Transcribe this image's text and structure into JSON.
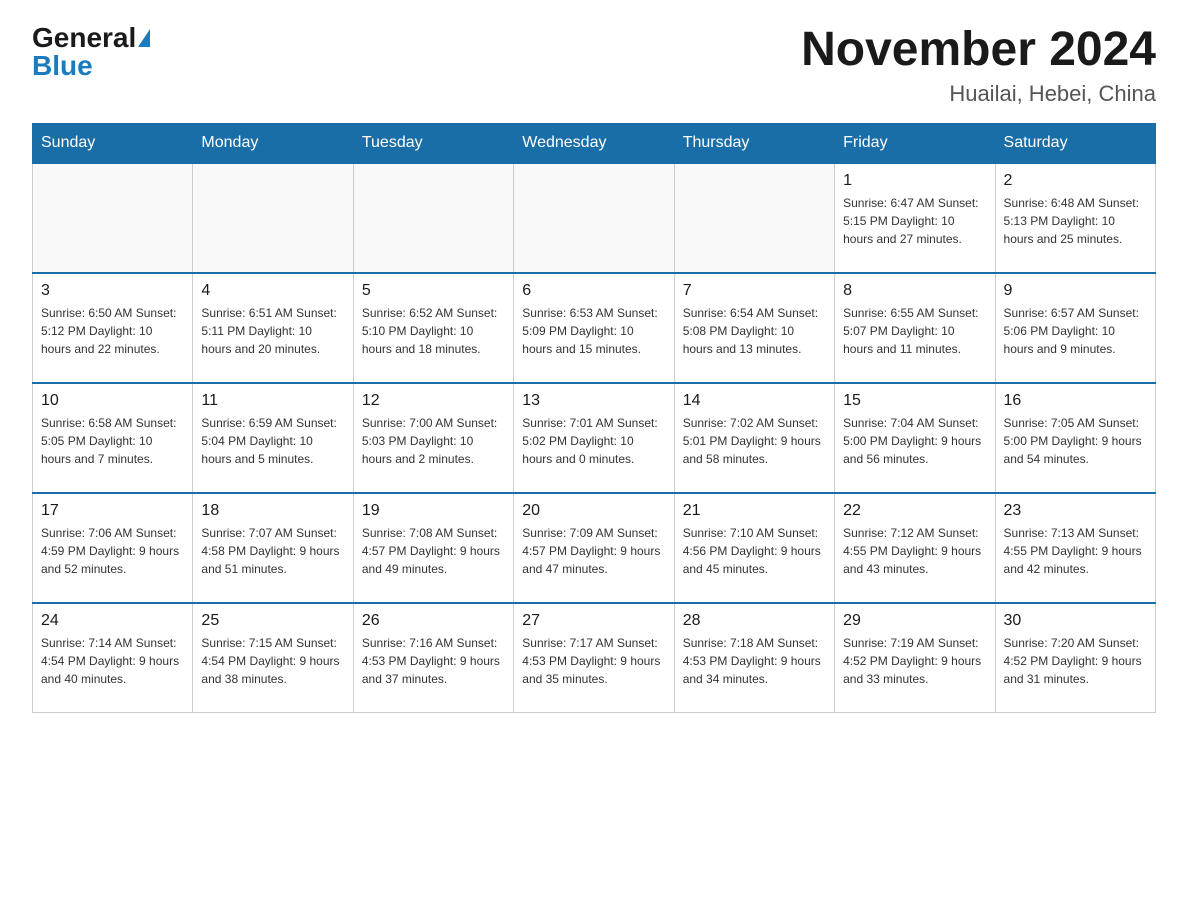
{
  "logo": {
    "general": "General",
    "blue": "Blue"
  },
  "title": "November 2024",
  "location": "Huailai, Hebei, China",
  "weekdays": [
    "Sunday",
    "Monday",
    "Tuesday",
    "Wednesday",
    "Thursday",
    "Friday",
    "Saturday"
  ],
  "weeks": [
    [
      {
        "day": "",
        "info": ""
      },
      {
        "day": "",
        "info": ""
      },
      {
        "day": "",
        "info": ""
      },
      {
        "day": "",
        "info": ""
      },
      {
        "day": "",
        "info": ""
      },
      {
        "day": "1",
        "info": "Sunrise: 6:47 AM\nSunset: 5:15 PM\nDaylight: 10 hours\nand 27 minutes."
      },
      {
        "day": "2",
        "info": "Sunrise: 6:48 AM\nSunset: 5:13 PM\nDaylight: 10 hours\nand 25 minutes."
      }
    ],
    [
      {
        "day": "3",
        "info": "Sunrise: 6:50 AM\nSunset: 5:12 PM\nDaylight: 10 hours\nand 22 minutes."
      },
      {
        "day": "4",
        "info": "Sunrise: 6:51 AM\nSunset: 5:11 PM\nDaylight: 10 hours\nand 20 minutes."
      },
      {
        "day": "5",
        "info": "Sunrise: 6:52 AM\nSunset: 5:10 PM\nDaylight: 10 hours\nand 18 minutes."
      },
      {
        "day": "6",
        "info": "Sunrise: 6:53 AM\nSunset: 5:09 PM\nDaylight: 10 hours\nand 15 minutes."
      },
      {
        "day": "7",
        "info": "Sunrise: 6:54 AM\nSunset: 5:08 PM\nDaylight: 10 hours\nand 13 minutes."
      },
      {
        "day": "8",
        "info": "Sunrise: 6:55 AM\nSunset: 5:07 PM\nDaylight: 10 hours\nand 11 minutes."
      },
      {
        "day": "9",
        "info": "Sunrise: 6:57 AM\nSunset: 5:06 PM\nDaylight: 10 hours\nand 9 minutes."
      }
    ],
    [
      {
        "day": "10",
        "info": "Sunrise: 6:58 AM\nSunset: 5:05 PM\nDaylight: 10 hours\nand 7 minutes."
      },
      {
        "day": "11",
        "info": "Sunrise: 6:59 AM\nSunset: 5:04 PM\nDaylight: 10 hours\nand 5 minutes."
      },
      {
        "day": "12",
        "info": "Sunrise: 7:00 AM\nSunset: 5:03 PM\nDaylight: 10 hours\nand 2 minutes."
      },
      {
        "day": "13",
        "info": "Sunrise: 7:01 AM\nSunset: 5:02 PM\nDaylight: 10 hours\nand 0 minutes."
      },
      {
        "day": "14",
        "info": "Sunrise: 7:02 AM\nSunset: 5:01 PM\nDaylight: 9 hours\nand 58 minutes."
      },
      {
        "day": "15",
        "info": "Sunrise: 7:04 AM\nSunset: 5:00 PM\nDaylight: 9 hours\nand 56 minutes."
      },
      {
        "day": "16",
        "info": "Sunrise: 7:05 AM\nSunset: 5:00 PM\nDaylight: 9 hours\nand 54 minutes."
      }
    ],
    [
      {
        "day": "17",
        "info": "Sunrise: 7:06 AM\nSunset: 4:59 PM\nDaylight: 9 hours\nand 52 minutes."
      },
      {
        "day": "18",
        "info": "Sunrise: 7:07 AM\nSunset: 4:58 PM\nDaylight: 9 hours\nand 51 minutes."
      },
      {
        "day": "19",
        "info": "Sunrise: 7:08 AM\nSunset: 4:57 PM\nDaylight: 9 hours\nand 49 minutes."
      },
      {
        "day": "20",
        "info": "Sunrise: 7:09 AM\nSunset: 4:57 PM\nDaylight: 9 hours\nand 47 minutes."
      },
      {
        "day": "21",
        "info": "Sunrise: 7:10 AM\nSunset: 4:56 PM\nDaylight: 9 hours\nand 45 minutes."
      },
      {
        "day": "22",
        "info": "Sunrise: 7:12 AM\nSunset: 4:55 PM\nDaylight: 9 hours\nand 43 minutes."
      },
      {
        "day": "23",
        "info": "Sunrise: 7:13 AM\nSunset: 4:55 PM\nDaylight: 9 hours\nand 42 minutes."
      }
    ],
    [
      {
        "day": "24",
        "info": "Sunrise: 7:14 AM\nSunset: 4:54 PM\nDaylight: 9 hours\nand 40 minutes."
      },
      {
        "day": "25",
        "info": "Sunrise: 7:15 AM\nSunset: 4:54 PM\nDaylight: 9 hours\nand 38 minutes."
      },
      {
        "day": "26",
        "info": "Sunrise: 7:16 AM\nSunset: 4:53 PM\nDaylight: 9 hours\nand 37 minutes."
      },
      {
        "day": "27",
        "info": "Sunrise: 7:17 AM\nSunset: 4:53 PM\nDaylight: 9 hours\nand 35 minutes."
      },
      {
        "day": "28",
        "info": "Sunrise: 7:18 AM\nSunset: 4:53 PM\nDaylight: 9 hours\nand 34 minutes."
      },
      {
        "day": "29",
        "info": "Sunrise: 7:19 AM\nSunset: 4:52 PM\nDaylight: 9 hours\nand 33 minutes."
      },
      {
        "day": "30",
        "info": "Sunrise: 7:20 AM\nSunset: 4:52 PM\nDaylight: 9 hours\nand 31 minutes."
      }
    ]
  ]
}
